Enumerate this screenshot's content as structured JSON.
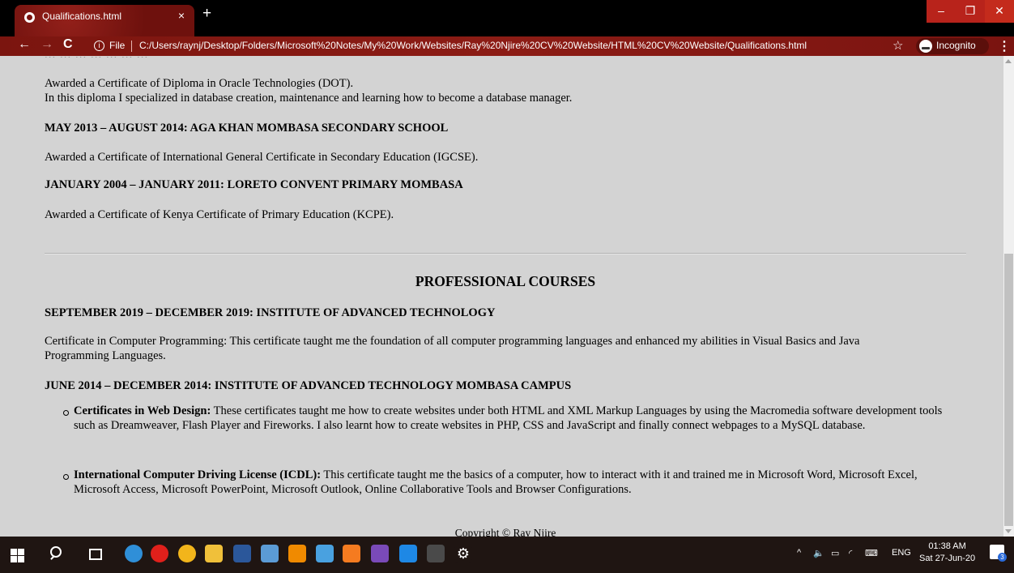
{
  "browser": {
    "tab_title": "Qualifications.html",
    "tab_close": "×",
    "new_tab": "+",
    "scheme_label": "File",
    "url": "C:/Users/raynj/Desktop/Folders/Microsoft%20Notes/My%20Work/Websites/Ray%20Njire%20CV%20Website/HTML%20CV%20Website/Qualifications.html",
    "incognito_label": "Incognito",
    "minimize": "–",
    "maximize": "❐",
    "close": "✕",
    "back": "←",
    "forward": "→",
    "reload": "C",
    "star": "☆",
    "menu": "⋮"
  },
  "page": {
    "cut_heading": "... ... ... ... ... ... ...",
    "p1_line1": "Awarded a Certificate of Diploma in Oracle Technologies (DOT).",
    "p1_line2": "In this diploma I specialized in database creation, maintenance and learning how to become a database manager.",
    "h2": "MAY 2013 – AUGUST 2014: AGA KHAN MOMBASA SECONDARY SCHOOL",
    "p2": "Awarded a Certificate of International General Certificate in Secondary Education (IGCSE).",
    "h3": "JANUARY 2004 – JANUARY 2011: LORETO CONVENT PRIMARY MOMBASA",
    "p3": "Awarded a Certificate of Kenya Certificate of Primary Education (KCPE).",
    "section_title": "PROFESSIONAL COURSES",
    "h4": "SEPTEMBER 2019 – DECEMBER 2019: INSTITUTE OF ADVANCED TECHNOLOGY",
    "p4_line1": "Certificate in Computer Programming: This certificate taught me the foundation of all computer programming languages and enhanced my abilities in Visual Basics and Java",
    "p4_line2": "Programming Languages.",
    "h5": "JUNE 2014 – DECEMBER 2014: INSTITUTE OF ADVANCED TECHNOLOGY MOMBASA CAMPUS",
    "items": [
      {
        "title": "Certificates in Web Design:",
        "text": "These certificates taught me how to create websites under both HTML and XML Markup Languages by using the Macromedia software development tools such as Dreamweaver, Flash Player and Fireworks. I also learnt how to create websites in PHP, CSS and JavaScript and finally connect webpages to a MySQL database."
      },
      {
        "title": "International Computer Driving License (ICDL):",
        "text": "This certificate taught me the basics of a computer, how to interact with it and trained me in Microsoft Word, Microsoft Excel, Microsoft Access, Microsoft PowerPoint, Microsoft Outlook, Online Collaborative Tools and Browser Configurations."
      }
    ],
    "footer": "Copyright © Ray Njire"
  },
  "taskbar": {
    "apps": [
      {
        "name": "edge-icon",
        "color": "#2f8fd8"
      },
      {
        "name": "opera-icon",
        "color": "#e0201b"
      },
      {
        "name": "chrome-icon",
        "color": "#f2b51b"
      },
      {
        "name": "file-explorer-icon",
        "color": "#f0c03a"
      },
      {
        "name": "word-icon",
        "color": "#2b579a"
      },
      {
        "name": "paint-icon",
        "color": "#5b9bd5"
      },
      {
        "name": "vlc-icon",
        "color": "#f08a00"
      },
      {
        "name": "3d-objects-icon",
        "color": "#49a1e0"
      },
      {
        "name": "xampp-icon",
        "color": "#f57b20"
      },
      {
        "name": "visual-studio-icon",
        "color": "#7a4ab8"
      },
      {
        "name": "app-icon",
        "color": "#1e88e5"
      },
      {
        "name": "terminal-icon",
        "color": "#4a4a4a"
      },
      {
        "name": "settings-icon",
        "color": "#1f1512"
      }
    ],
    "tray_arrow": "^",
    "language": "ENG",
    "time": "01:38 AM",
    "date": "Sat 27-Jun-20",
    "notification_count": "3"
  }
}
